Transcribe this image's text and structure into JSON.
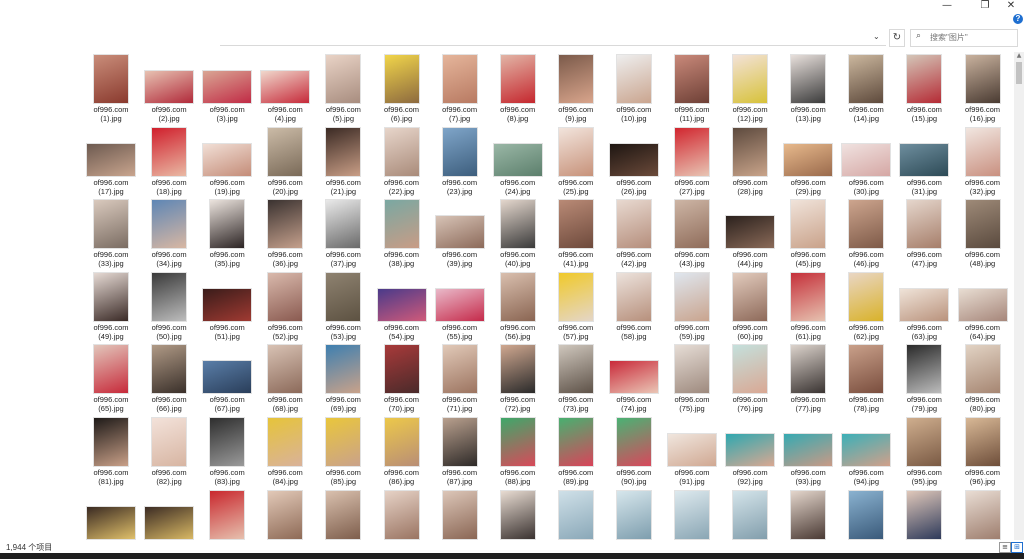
{
  "window": {
    "minimize_glyph": "—",
    "maximize_glyph": "❐",
    "close_glyph": "✕"
  },
  "address_bar": {
    "dropdown_glyph": "⌄",
    "refresh_glyph": "↻"
  },
  "search": {
    "placeholder": "搜索\"图片\"",
    "icon": "search-icon"
  },
  "help_glyph": "?",
  "files": [
    {
      "name": "of996.com",
      "sub": "(1).jpg",
      "o": "p",
      "c": [
        "#c98d7a",
        "#8a3a2e"
      ]
    },
    {
      "name": "of996.com",
      "sub": "(2).jpg",
      "o": "l",
      "c": [
        "#e7c2b2",
        "#b12a3a"
      ]
    },
    {
      "name": "of996.com",
      "sub": "(3).jpg",
      "o": "l",
      "c": [
        "#d9a694",
        "#c12b45"
      ]
    },
    {
      "name": "of996.com",
      "sub": "(4).jpg",
      "o": "l",
      "c": [
        "#f0d8cc",
        "#c62a3a"
      ]
    },
    {
      "name": "of996.com",
      "sub": "(5).jpg",
      "o": "p",
      "c": [
        "#e9d3c6",
        "#a88d7f"
      ]
    },
    {
      "name": "of996.com",
      "sub": "(6).jpg",
      "o": "p",
      "c": [
        "#f1d54a",
        "#8d6a3f"
      ]
    },
    {
      "name": "of996.com",
      "sub": "(7).jpg",
      "o": "p",
      "c": [
        "#e5b59b",
        "#b87a62"
      ]
    },
    {
      "name": "of996.com",
      "sub": "(8).jpg",
      "o": "p",
      "c": [
        "#e2b5a6",
        "#c5272e"
      ]
    },
    {
      "name": "of996.com",
      "sub": "(9).jpg",
      "o": "p",
      "c": [
        "#7b5a4a",
        "#d9a58c"
      ]
    },
    {
      "name": "of996.com",
      "sub": "(10).jpg",
      "o": "p",
      "c": [
        "#eeeeee",
        "#caa58f"
      ]
    },
    {
      "name": "of996.com",
      "sub": "(11).jpg",
      "o": "p",
      "c": [
        "#c9897a",
        "#6e4036"
      ]
    },
    {
      "name": "of996.com",
      "sub": "(12).jpg",
      "o": "p",
      "c": [
        "#f3e2d8",
        "#d7c23a"
      ]
    },
    {
      "name": "of996.com",
      "sub": "(13).jpg",
      "o": "p",
      "c": [
        "#e8e0dc",
        "#3c3c3c"
      ]
    },
    {
      "name": "of996.com",
      "sub": "(14).jpg",
      "o": "p",
      "c": [
        "#cbb79e",
        "#5e4a3c"
      ]
    },
    {
      "name": "of996.com",
      "sub": "(15).jpg",
      "o": "p",
      "c": [
        "#d4c6b8",
        "#b52b35"
      ]
    },
    {
      "name": "of996.com",
      "sub": "(16).jpg",
      "o": "p",
      "c": [
        "#c9b29e",
        "#4a3b32"
      ]
    },
    {
      "name": "of996.com",
      "sub": "(17).jpg",
      "o": "l",
      "c": [
        "#6d5a50",
        "#c9a58e"
      ]
    },
    {
      "name": "of996.com",
      "sub": "(18).jpg",
      "o": "p",
      "c": [
        "#d01f2c",
        "#e9b9a4"
      ]
    },
    {
      "name": "of996.com",
      "sub": "(19).jpg",
      "o": "l",
      "c": [
        "#f1dfd6",
        "#c48c78"
      ]
    },
    {
      "name": "of996.com",
      "sub": "(20).jpg",
      "o": "p",
      "c": [
        "#cbbba7",
        "#7a6a58"
      ]
    },
    {
      "name": "of996.com",
      "sub": "(21).jpg",
      "o": "p",
      "c": [
        "#3b2a24",
        "#c99e86"
      ]
    },
    {
      "name": "of996.com",
      "sub": "(22).jpg",
      "o": "p",
      "c": [
        "#e7d5ca",
        "#a98b7a"
      ]
    },
    {
      "name": "of996.com",
      "sub": "(23).jpg",
      "o": "p",
      "c": [
        "#7fa5c9",
        "#3d5e7d"
      ]
    },
    {
      "name": "of996.com",
      "sub": "(24).jpg",
      "o": "l",
      "c": [
        "#9ab7a6",
        "#5c7f6c"
      ]
    },
    {
      "name": "of996.com",
      "sub": "(25).jpg",
      "o": "p",
      "c": [
        "#f2e4dc",
        "#c7927a"
      ]
    },
    {
      "name": "of996.com",
      "sub": "(26).jpg",
      "o": "l",
      "c": [
        "#1e1612",
        "#6b4a3a"
      ]
    },
    {
      "name": "of996.com",
      "sub": "(27).jpg",
      "o": "p",
      "c": [
        "#d1262f",
        "#e8c5b4"
      ]
    },
    {
      "name": "of996.com",
      "sub": "(28).jpg",
      "o": "p",
      "c": [
        "#5d4a3e",
        "#c9a48a"
      ]
    },
    {
      "name": "of996.com",
      "sub": "(29).jpg",
      "o": "l",
      "c": [
        "#e7b98c",
        "#9a6a4c"
      ]
    },
    {
      "name": "of996.com",
      "sub": "(30).jpg",
      "o": "l",
      "c": [
        "#f0e2e0",
        "#d5a7a4"
      ]
    },
    {
      "name": "of996.com",
      "sub": "(31).jpg",
      "o": "l",
      "c": [
        "#6e8e9e",
        "#2d4a56"
      ]
    },
    {
      "name": "of996.com",
      "sub": "(32).jpg",
      "o": "p",
      "c": [
        "#f1e6e0",
        "#c99080"
      ]
    },
    {
      "name": "of996.com",
      "sub": "(33).jpg",
      "o": "p",
      "c": [
        "#d9c9bd",
        "#7a6c62"
      ]
    },
    {
      "name": "of996.com",
      "sub": "(34).jpg",
      "o": "p",
      "c": [
        "#5e86b5",
        "#d8b7a3"
      ]
    },
    {
      "name": "of996.com",
      "sub": "(35).jpg",
      "o": "p",
      "c": [
        "#ece4de",
        "#2c2424"
      ]
    },
    {
      "name": "of996.com",
      "sub": "(36).jpg",
      "o": "p",
      "c": [
        "#3a3230",
        "#c5a08c"
      ]
    },
    {
      "name": "of996.com",
      "sub": "(37).jpg",
      "o": "p",
      "c": [
        "#e9e9e9",
        "#6a6a6a"
      ]
    },
    {
      "name": "of996.com",
      "sub": "(38).jpg",
      "o": "p",
      "c": [
        "#7aa8a2",
        "#c89c86"
      ]
    },
    {
      "name": "of996.com",
      "sub": "(39).jpg",
      "o": "l",
      "c": [
        "#d7c3b6",
        "#8c6a5a"
      ]
    },
    {
      "name": "of996.com",
      "sub": "(40).jpg",
      "o": "p",
      "c": [
        "#e4d7cd",
        "#3a3a3a"
      ]
    },
    {
      "name": "of996.com",
      "sub": "(41).jpg",
      "o": "p",
      "c": [
        "#b98a76",
        "#6e4a3c"
      ]
    },
    {
      "name": "of996.com",
      "sub": "(42).jpg",
      "o": "p",
      "c": [
        "#e8d9d0",
        "#b58e7c"
      ]
    },
    {
      "name": "of996.com",
      "sub": "(43).jpg",
      "o": "p",
      "c": [
        "#cdb5a5",
        "#8f6c5a"
      ]
    },
    {
      "name": "of996.com",
      "sub": "(44).jpg",
      "o": "l",
      "c": [
        "#2b211d",
        "#8a6a58"
      ]
    },
    {
      "name": "of996.com",
      "sub": "(45).jpg",
      "o": "p",
      "c": [
        "#f0e3da",
        "#c9a28a"
      ]
    },
    {
      "name": "of996.com",
      "sub": "(46).jpg",
      "o": "p",
      "c": [
        "#cda58e",
        "#7e5a48"
      ]
    },
    {
      "name": "of996.com",
      "sub": "(47).jpg",
      "o": "p",
      "c": [
        "#e5d6cc",
        "#a67e6a"
      ]
    },
    {
      "name": "of996.com",
      "sub": "(48).jpg",
      "o": "p",
      "c": [
        "#9e8a78",
        "#5a4a3e"
      ]
    },
    {
      "name": "of996.com",
      "sub": "(49).jpg",
      "o": "p",
      "c": [
        "#e6dad4",
        "#3a2a26"
      ]
    },
    {
      "name": "of996.com",
      "sub": "(50).jpg",
      "o": "p",
      "c": [
        "#3a3a3a",
        "#bdbdbd"
      ]
    },
    {
      "name": "of996.com",
      "sub": "(51).jpg",
      "o": "l",
      "c": [
        "#3a1c1a",
        "#a03a32"
      ]
    },
    {
      "name": "of996.com",
      "sub": "(52).jpg",
      "o": "p",
      "c": [
        "#d9b9ac",
        "#8a5a50"
      ]
    },
    {
      "name": "of996.com",
      "sub": "(53).jpg",
      "o": "p",
      "c": [
        "#8e8270",
        "#5d5242"
      ]
    },
    {
      "name": "of996.com",
      "sub": "(54).jpg",
      "o": "l",
      "c": [
        "#4a3a8a",
        "#d05a7a"
      ]
    },
    {
      "name": "of996.com",
      "sub": "(55).jpg",
      "o": "l",
      "c": [
        "#e9b9c9",
        "#c52a4a"
      ]
    },
    {
      "name": "of996.com",
      "sub": "(56).jpg",
      "o": "p",
      "c": [
        "#d9bfae",
        "#8a6552"
      ]
    },
    {
      "name": "of996.com",
      "sub": "(57).jpg",
      "o": "p",
      "c": [
        "#f0c92a",
        "#e4d6c8"
      ]
    },
    {
      "name": "of996.com",
      "sub": "(58).jpg",
      "o": "p",
      "c": [
        "#ece2dc",
        "#b7907c"
      ]
    },
    {
      "name": "of996.com",
      "sub": "(59).jpg",
      "o": "p",
      "c": [
        "#dfe6ee",
        "#c9a48e"
      ]
    },
    {
      "name": "of996.com",
      "sub": "(60).jpg",
      "o": "p",
      "c": [
        "#e2cbbd",
        "#8e6a5a"
      ]
    },
    {
      "name": "of996.com",
      "sub": "(61).jpg",
      "o": "p",
      "c": [
        "#c5303a",
        "#e6c2b0"
      ]
    },
    {
      "name": "of996.com",
      "sub": "(62).jpg",
      "o": "p",
      "c": [
        "#e9d6c4",
        "#d9b22a"
      ]
    },
    {
      "name": "of996.com",
      "sub": "(63).jpg",
      "o": "l",
      "c": [
        "#efe3d8",
        "#b9927c"
      ]
    },
    {
      "name": "of996.com",
      "sub": "(64).jpg",
      "o": "l",
      "c": [
        "#e8ddd2",
        "#a6867a"
      ]
    },
    {
      "name": "of996.com",
      "sub": "(65).jpg",
      "o": "p",
      "c": [
        "#e2c6bb",
        "#c72a3a"
      ]
    },
    {
      "name": "of996.com",
      "sub": "(66).jpg",
      "o": "p",
      "c": [
        "#b09a86",
        "#3a302a"
      ]
    },
    {
      "name": "of996.com",
      "sub": "(67).jpg",
      "o": "l",
      "c": [
        "#5a7ea8",
        "#2a3e5a"
      ]
    },
    {
      "name": "of996.com",
      "sub": "(68).jpg",
      "o": "p",
      "c": [
        "#d8c2b4",
        "#8c6a5a"
      ]
    },
    {
      "name": "of996.com",
      "sub": "(69).jpg",
      "o": "p",
      "c": [
        "#3e7fb0",
        "#c9a28a"
      ]
    },
    {
      "name": "of996.com",
      "sub": "(70).jpg",
      "o": "p",
      "c": [
        "#a83a3a",
        "#4a2a2a"
      ]
    },
    {
      "name": "of996.com",
      "sub": "(71).jpg",
      "o": "p",
      "c": [
        "#e1c9b8",
        "#9c7460"
      ]
    },
    {
      "name": "of996.com",
      "sub": "(72).jpg",
      "o": "p",
      "c": [
        "#d0a890",
        "#2a2a2a"
      ]
    },
    {
      "name": "of996.com",
      "sub": "(73).jpg",
      "o": "p",
      "c": [
        "#cfc7bd",
        "#5e5248"
      ]
    },
    {
      "name": "of996.com",
      "sub": "(74).jpg",
      "o": "l",
      "c": [
        "#c92a3a",
        "#eac6b6"
      ]
    },
    {
      "name": "of996.com",
      "sub": "(75).jpg",
      "o": "p",
      "c": [
        "#e6ddd6",
        "#9e8a7e"
      ]
    },
    {
      "name": "of996.com",
      "sub": "(76).jpg",
      "o": "p",
      "c": [
        "#c4e0dc",
        "#d9a894"
      ]
    },
    {
      "name": "of996.com",
      "sub": "(77).jpg",
      "o": "p",
      "c": [
        "#dcd3cc",
        "#3a3432"
      ]
    },
    {
      "name": "of996.com",
      "sub": "(78).jpg",
      "o": "p",
      "c": [
        "#c9a08a",
        "#7a4e3e"
      ]
    },
    {
      "name": "of996.com",
      "sub": "(79).jpg",
      "o": "p",
      "c": [
        "#2a2a2a",
        "#bcbcbc"
      ]
    },
    {
      "name": "of996.com",
      "sub": "(80).jpg",
      "o": "p",
      "c": [
        "#e2d3c4",
        "#a68672"
      ]
    },
    {
      "name": "of996.com",
      "sub": "(81).jpg",
      "o": "p",
      "c": [
        "#1e1a18",
        "#c9a088"
      ]
    },
    {
      "name": "of996.com",
      "sub": "(82).jpg",
      "o": "p",
      "c": [
        "#f3e2da",
        "#d7b5a2"
      ]
    },
    {
      "name": "of996.com",
      "sub": "(83).jpg",
      "o": "p",
      "c": [
        "#2e2e2e",
        "#9a9a9a"
      ]
    },
    {
      "name": "of996.com",
      "sub": "(84).jpg",
      "o": "p",
      "c": [
        "#e6c43a",
        "#d9b29a"
      ]
    },
    {
      "name": "of996.com",
      "sub": "(85).jpg",
      "o": "p",
      "c": [
        "#e9c63c",
        "#caa28a"
      ]
    },
    {
      "name": "of996.com",
      "sub": "(86).jpg",
      "o": "p",
      "c": [
        "#ecc84a",
        "#b98e76"
      ]
    },
    {
      "name": "of996.com",
      "sub": "(87).jpg",
      "o": "p",
      "c": [
        "#b9a08e",
        "#2e2a28"
      ]
    },
    {
      "name": "of996.com",
      "sub": "(88).jpg",
      "o": "p",
      "c": [
        "#3ea86a",
        "#d84a5a"
      ]
    },
    {
      "name": "of996.com",
      "sub": "(89).jpg",
      "o": "p",
      "c": [
        "#48b070",
        "#d9445a"
      ]
    },
    {
      "name": "of996.com",
      "sub": "(90).jpg",
      "o": "p",
      "c": [
        "#4ab274",
        "#d8485c"
      ]
    },
    {
      "name": "of996.com",
      "sub": "(91).jpg",
      "o": "l",
      "c": [
        "#f0e6de",
        "#d0a892"
      ]
    },
    {
      "name": "of996.com",
      "sub": "(92).jpg",
      "o": "l",
      "c": [
        "#2fa8b0",
        "#d9a892"
      ]
    },
    {
      "name": "of996.com",
      "sub": "(93).jpg",
      "o": "l",
      "c": [
        "#36aab2",
        "#c99a86"
      ]
    },
    {
      "name": "of996.com",
      "sub": "(94).jpg",
      "o": "l",
      "c": [
        "#3cb0b8",
        "#d1a08a"
      ]
    },
    {
      "name": "of996.com",
      "sub": "(95).jpg",
      "o": "p",
      "c": [
        "#cfae8e",
        "#7a5a44"
      ]
    },
    {
      "name": "of996.com",
      "sub": "(96).jpg",
      "o": "p",
      "c": [
        "#d8b896",
        "#6e4e3a"
      ]
    },
    {
      "name": "",
      "sub": "",
      "o": "l",
      "c": [
        "#3a2a22",
        "#e0c06a"
      ]
    },
    {
      "name": "",
      "sub": "",
      "o": "l",
      "c": [
        "#3c2c24",
        "#d8b864"
      ]
    },
    {
      "name": "",
      "sub": "",
      "o": "p",
      "c": [
        "#c9282e",
        "#e6c0ae"
      ]
    },
    {
      "name": "",
      "sub": "",
      "o": "p",
      "c": [
        "#e2c9b8",
        "#8e6a56"
      ]
    },
    {
      "name": "",
      "sub": "",
      "o": "p",
      "c": [
        "#d9c0ae",
        "#7e5e4c"
      ]
    },
    {
      "name": "",
      "sub": "",
      "o": "p",
      "c": [
        "#e6d2c6",
        "#9a7462"
      ]
    },
    {
      "name": "",
      "sub": "",
      "o": "p",
      "c": [
        "#dcc6b8",
        "#8a6654"
      ]
    },
    {
      "name": "",
      "sub": "",
      "o": "p",
      "c": [
        "#e8dcd2",
        "#3a3230"
      ]
    },
    {
      "name": "",
      "sub": "",
      "o": "p",
      "c": [
        "#cfe0e8",
        "#8aa8b8"
      ]
    },
    {
      "name": "",
      "sub": "",
      "o": "p",
      "c": [
        "#d6e6ec",
        "#7e9eae"
      ]
    },
    {
      "name": "",
      "sub": "",
      "o": "p",
      "c": [
        "#dde9ee",
        "#8aa6b4"
      ]
    },
    {
      "name": "",
      "sub": "",
      "o": "p",
      "c": [
        "#d4e4ea",
        "#829eac"
      ]
    },
    {
      "name": "",
      "sub": "",
      "o": "p",
      "c": [
        "#e4d6cc",
        "#4a3a34"
      ]
    },
    {
      "name": "",
      "sub": "",
      "o": "p",
      "c": [
        "#8ab2d0",
        "#3a5a7a"
      ]
    },
    {
      "name": "",
      "sub": "",
      "o": "p",
      "c": [
        "#e0c8ba",
        "#2e3a5a"
      ]
    },
    {
      "name": "",
      "sub": "",
      "o": "p",
      "c": [
        "#e9ddd4",
        "#9e7e6e"
      ]
    }
  ],
  "status": {
    "item_count": "1,944 个项目"
  },
  "view_buttons": {
    "details_glyph": "≡",
    "icons_glyph": "⊞"
  },
  "scrollbar": {
    "up_glyph": "▲"
  }
}
